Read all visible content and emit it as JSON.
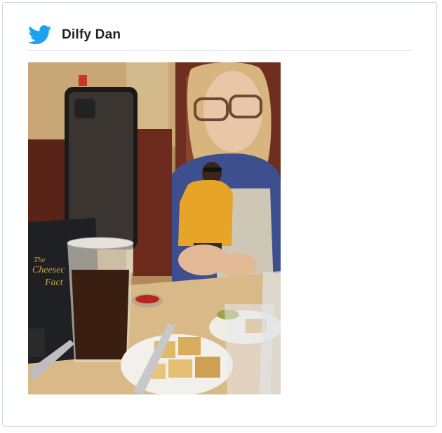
{
  "tweet": {
    "author_name": "Dilfy Dan",
    "platform_icon": "twitter-bird-icon",
    "brand_color": "#1da1f2",
    "media": {
      "type": "photo",
      "menu_logo_line1": "The",
      "menu_logo_line2": "Cheesec",
      "menu_logo_line3": "Fact"
    }
  }
}
